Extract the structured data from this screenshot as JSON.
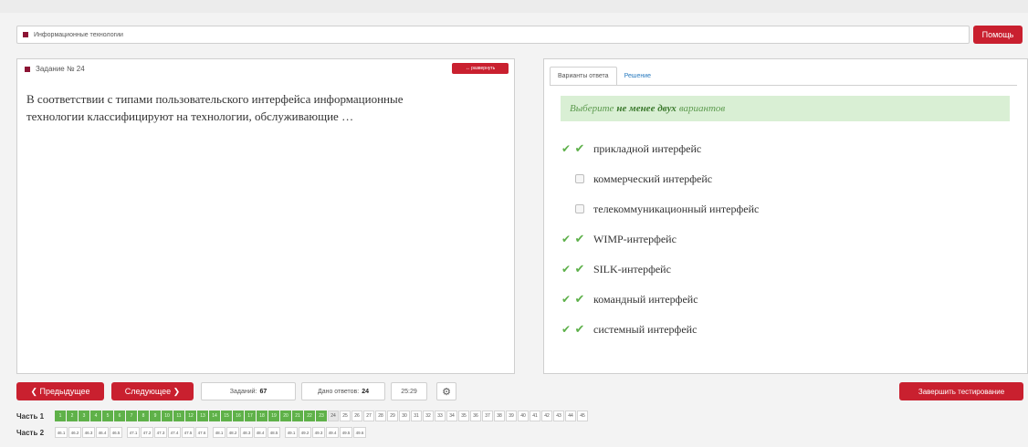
{
  "header": {
    "subject": "Информационные технологии",
    "help_label": "Помощь"
  },
  "task": {
    "title": "Задание № 24",
    "expand_label": "↔ развернуть",
    "question": "В соответствии с типами пользовательского интерфейса информационные технологии классифицируют на технологии, обслуживающие …"
  },
  "answer": {
    "tabs": [
      {
        "label": "Варианты ответа",
        "active": true
      },
      {
        "label": "Решение",
        "active": false
      }
    ],
    "hint_pre": "Выберите",
    "hint_bold": "не менее двух",
    "hint_post": "вариантов",
    "options": [
      {
        "label": "прикладной интерфейс",
        "checked": true,
        "correct": true
      },
      {
        "label": "коммерческий интерфейс",
        "checked": false,
        "correct": false
      },
      {
        "label": "телекоммуникационный интерфейс",
        "checked": false,
        "correct": false
      },
      {
        "label": "WIMP-интерфейс",
        "checked": true,
        "correct": true
      },
      {
        "label": "SILK-интерфейс",
        "checked": true,
        "correct": true
      },
      {
        "label": "командный интерфейс",
        "checked": true,
        "correct": true
      },
      {
        "label": "системный интерфейс",
        "checked": true,
        "correct": true
      }
    ]
  },
  "footer": {
    "prev_label": "❮ Предыдущее",
    "next_label": "Следующее ❯",
    "tasks_label": "Заданий:",
    "tasks_value": "67",
    "answered_label": "Дано ответов:",
    "answered_value": "24",
    "timer": "25:29",
    "gear_icon": "gear-icon",
    "finish_label": "Завершить тестирование"
  },
  "parts": {
    "part1_label": "Часть 1",
    "part1_done_count": 23,
    "part1_current": "24",
    "part1_items": [
      "1",
      "2",
      "3",
      "4",
      "5",
      "6",
      "7",
      "8",
      "9",
      "10",
      "11",
      "12",
      "13",
      "14",
      "15",
      "16",
      "17",
      "18",
      "19",
      "20",
      "21",
      "22",
      "23",
      "24",
      "25",
      "26",
      "27",
      "28",
      "29",
      "30",
      "31",
      "32",
      "33",
      "34",
      "35",
      "36",
      "37",
      "38",
      "39",
      "40",
      "41",
      "42",
      "43",
      "44",
      "45"
    ],
    "part2_label": "Часть 2",
    "part2_groups": [
      [
        "46.1",
        "46.2",
        "46.3",
        "46.4",
        "46.5"
      ],
      [
        "47.1",
        "47.2",
        "47.3",
        "47.4",
        "47.5",
        "47.6"
      ],
      [
        "48.1",
        "48.2",
        "48.3",
        "48.4",
        "48.5"
      ],
      [
        "49.1",
        "49.2",
        "49.3",
        "49.4",
        "49.5",
        "49.6"
      ]
    ]
  },
  "colors": {
    "accent_red": "#c9202f",
    "brand_maroon": "#8c1434",
    "success_green": "#5fb149",
    "hint_bg": "#d9efd4"
  }
}
